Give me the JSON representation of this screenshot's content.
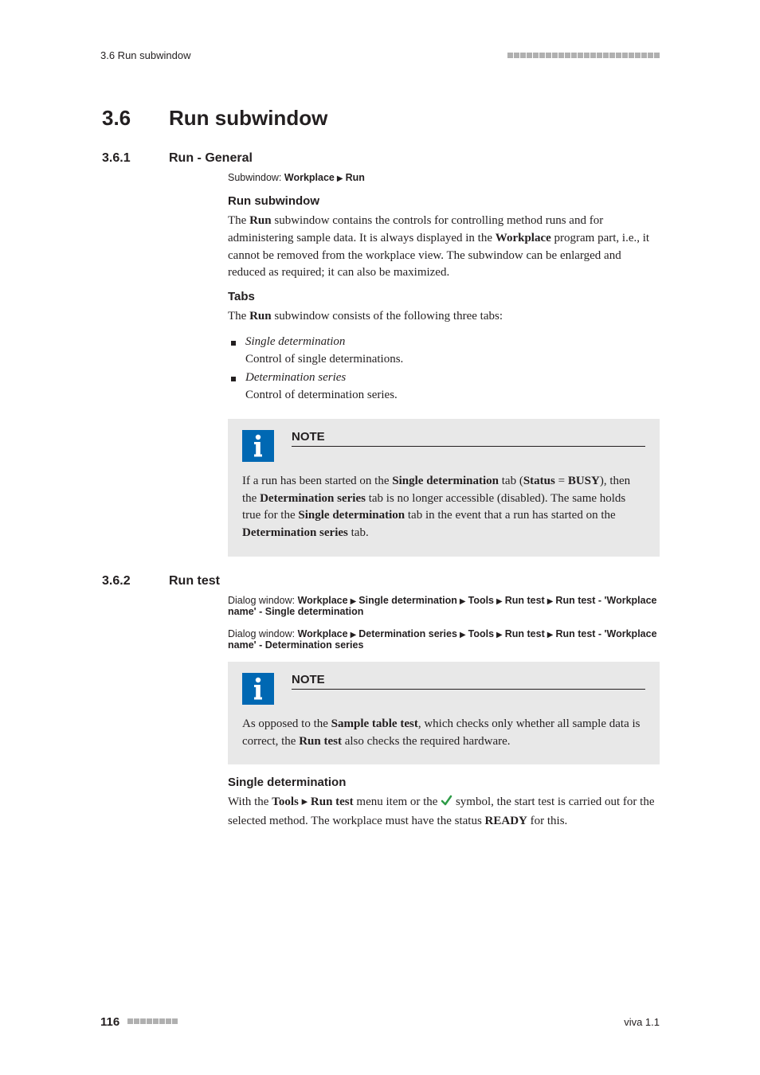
{
  "header": {
    "left": "3.6 Run subwindow"
  },
  "h1": {
    "num": "3.6",
    "title": "Run subwindow"
  },
  "s361": {
    "num": "3.6.1",
    "title": "Run - General",
    "bc_label": "Subwindow:",
    "bc_p1": "Workplace",
    "bc_p2": "Run",
    "h3a": "Run subwindow",
    "p1a": "The ",
    "p1b": "Run",
    "p1c": " subwindow contains the controls for controlling method runs and for administering sample data. It is always displayed in the ",
    "p1d": "Workplace",
    "p1e": " program part, i.e., it cannot be removed from the workplace view. The subwindow can be enlarged and reduced as required; it can also be maximized.",
    "h3b": "Tabs",
    "p2a": "The ",
    "p2b": "Run",
    "p2c": " subwindow consists of the following three tabs:",
    "tab1t": "Single determination",
    "tab1d": "Control of single determinations.",
    "tab2t": "Determination series",
    "tab2d": "Control of determination series.",
    "note_title": "NOTE",
    "note_a": "If a run has been started on the ",
    "note_b": "Single determination",
    "note_c": " tab (",
    "note_d": "Status",
    "note_e": " = ",
    "note_f": "BUSY",
    "note_g": "), then the ",
    "note_h": "Determination series",
    "note_i": " tab is no longer accessible (disabled). The same holds true for the ",
    "note_j": "Single determination",
    "note_k": " tab in the event that a run has started on the ",
    "note_l": "Determination series",
    "note_m": " tab."
  },
  "s362": {
    "num": "3.6.2",
    "title": "Run test",
    "bc1_label": "Dialog window:",
    "bc1_p1": "Workplace",
    "bc1_p2": "Single determination",
    "bc1_p3": "Tools",
    "bc1_p4": "Run test",
    "bc1_p5": "Run test - 'Workplace name' - Single determination",
    "bc2_label": "Dialog window:",
    "bc2_p1": "Workplace",
    "bc2_p2": "Determination series",
    "bc2_p3": "Tools",
    "bc2_p4": "Run test",
    "bc2_p5": "Run test - 'Workplace name' - Determination series",
    "note_title": "NOTE",
    "note_a": "As opposed to the ",
    "note_b": "Sample table test",
    "note_c": ", which checks only whether all sample data is correct, the ",
    "note_d": "Run test",
    "note_e": " also checks the required hardware.",
    "h3": "Single determination",
    "p_a": "With the ",
    "p_b": "Tools",
    "p_c": "Run test",
    "p_d": " menu item or the ",
    "p_e": " symbol, the start test is carried out for the selected method. The workplace must have the status ",
    "p_f": "READY",
    "p_g": " for this."
  },
  "footer": {
    "page": "116",
    "right": "viva 1.1"
  }
}
